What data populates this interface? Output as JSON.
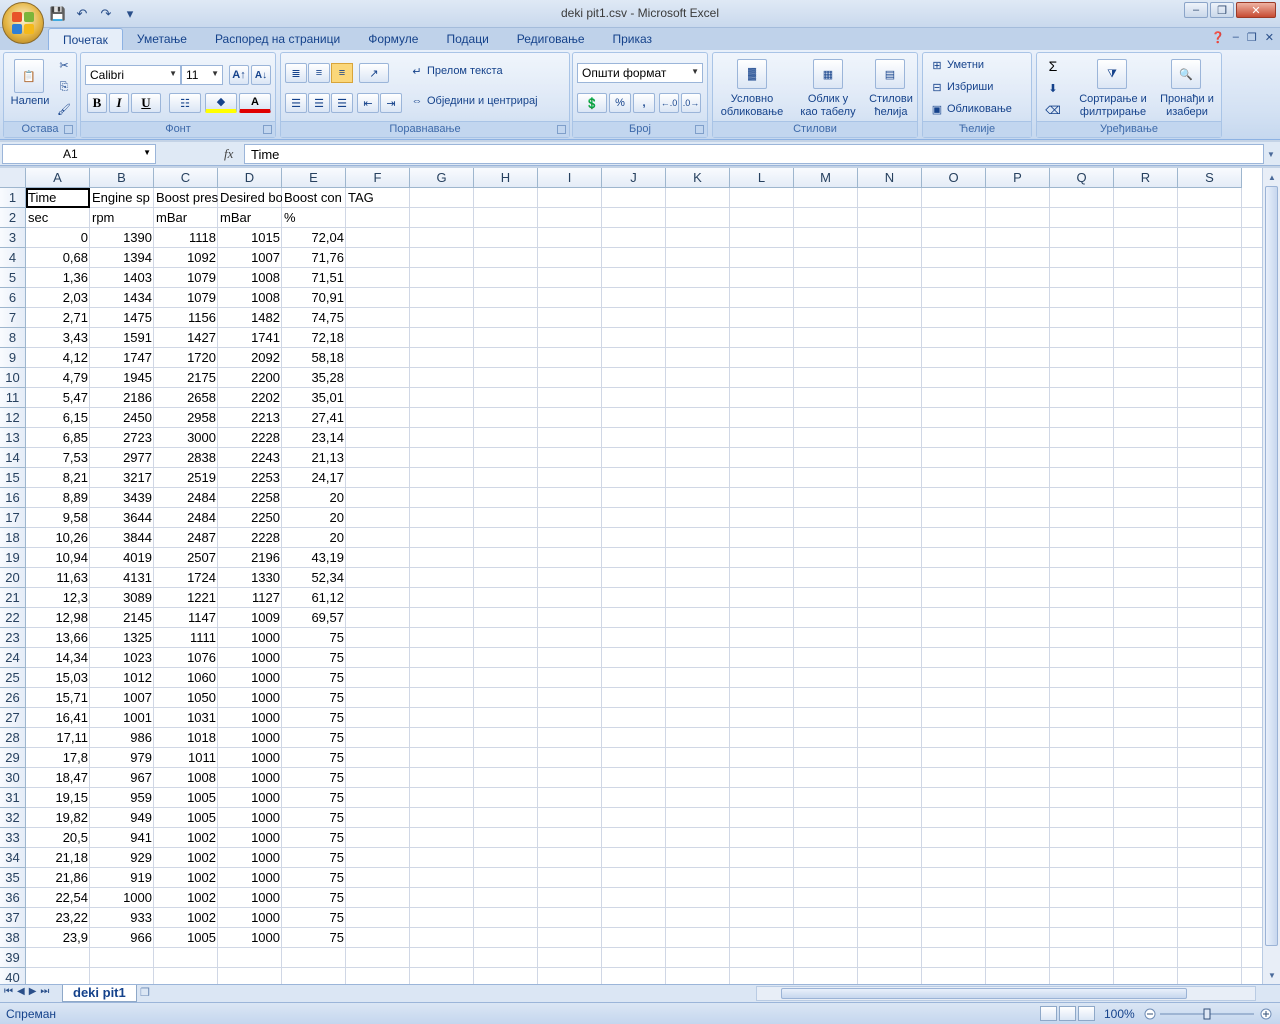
{
  "window": {
    "title": "deki pit1.csv - Microsoft Excel"
  },
  "ribbon_tabs": [
    "Почетак",
    "Уметање",
    "Распоред на страници",
    "Формуле",
    "Подаци",
    "Редиговање",
    "Приказ"
  ],
  "ribbon": {
    "clipboard": {
      "label": "Остава",
      "paste": "Налепи"
    },
    "font": {
      "label": "Фонт",
      "name": "Calibri",
      "size": "11"
    },
    "alignment": {
      "label": "Поравнавање",
      "wrap": "Прелом текста",
      "merge": "Обједини и центрирај"
    },
    "number": {
      "label": "Број",
      "format": "Општи формат",
      "percent": "%",
      "comma": ","
    },
    "styles": {
      "label": "Стилови",
      "conditional": [
        "Условно",
        "обликовање"
      ],
      "table": [
        "Облик у",
        "као табелу"
      ],
      "cell": [
        "Стилови",
        "ћелија"
      ]
    },
    "cells": {
      "label": "Ћелије",
      "insert": "Уметни",
      "delete": "Избриши",
      "format": "Обликовање"
    },
    "editing": {
      "label": "Уређивање",
      "sort": [
        "Сортирање и",
        "филтрирање"
      ],
      "find": [
        "Пронађи и",
        "изабери"
      ]
    }
  },
  "formula_bar": {
    "name_box": "A1",
    "fx": "fx",
    "content": "Time"
  },
  "columns": [
    "A",
    "B",
    "C",
    "D",
    "E",
    "F",
    "G",
    "H",
    "I",
    "J",
    "K",
    "L",
    "M",
    "N",
    "O",
    "P",
    "Q",
    "R",
    "S"
  ],
  "rows": [
    [
      "Time",
      "Engine sp",
      "Boost pres",
      "Desired bo",
      "Boost con",
      "TAG"
    ],
    [
      "sec",
      "rpm",
      "mBar",
      "mBar",
      "%",
      ""
    ],
    [
      "0",
      "1390",
      "1118",
      "1015",
      "72,04"
    ],
    [
      "0,68",
      "1394",
      "1092",
      "1007",
      "71,76"
    ],
    [
      "1,36",
      "1403",
      "1079",
      "1008",
      "71,51"
    ],
    [
      "2,03",
      "1434",
      "1079",
      "1008",
      "70,91"
    ],
    [
      "2,71",
      "1475",
      "1156",
      "1482",
      "74,75"
    ],
    [
      "3,43",
      "1591",
      "1427",
      "1741",
      "72,18"
    ],
    [
      "4,12",
      "1747",
      "1720",
      "2092",
      "58,18"
    ],
    [
      "4,79",
      "1945",
      "2175",
      "2200",
      "35,28"
    ],
    [
      "5,47",
      "2186",
      "2658",
      "2202",
      "35,01"
    ],
    [
      "6,15",
      "2450",
      "2958",
      "2213",
      "27,41"
    ],
    [
      "6,85",
      "2723",
      "3000",
      "2228",
      "23,14"
    ],
    [
      "7,53",
      "2977",
      "2838",
      "2243",
      "21,13"
    ],
    [
      "8,21",
      "3217",
      "2519",
      "2253",
      "24,17"
    ],
    [
      "8,89",
      "3439",
      "2484",
      "2258",
      "20"
    ],
    [
      "9,58",
      "3644",
      "2484",
      "2250",
      "20"
    ],
    [
      "10,26",
      "3844",
      "2487",
      "2228",
      "20"
    ],
    [
      "10,94",
      "4019",
      "2507",
      "2196",
      "43,19"
    ],
    [
      "11,63",
      "4131",
      "1724",
      "1330",
      "52,34"
    ],
    [
      "12,3",
      "3089",
      "1221",
      "1127",
      "61,12"
    ],
    [
      "12,98",
      "2145",
      "1147",
      "1009",
      "69,57"
    ],
    [
      "13,66",
      "1325",
      "1111",
      "1000",
      "75"
    ],
    [
      "14,34",
      "1023",
      "1076",
      "1000",
      "75"
    ],
    [
      "15,03",
      "1012",
      "1060",
      "1000",
      "75"
    ],
    [
      "15,71",
      "1007",
      "1050",
      "1000",
      "75"
    ],
    [
      "16,41",
      "1001",
      "1031",
      "1000",
      "75"
    ],
    [
      "17,11",
      "986",
      "1018",
      "1000",
      "75"
    ],
    [
      "17,8",
      "979",
      "1011",
      "1000",
      "75"
    ],
    [
      "18,47",
      "967",
      "1008",
      "1000",
      "75"
    ],
    [
      "19,15",
      "959",
      "1005",
      "1000",
      "75"
    ],
    [
      "19,82",
      "949",
      "1005",
      "1000",
      "75"
    ],
    [
      "20,5",
      "941",
      "1002",
      "1000",
      "75"
    ],
    [
      "21,18",
      "929",
      "1002",
      "1000",
      "75"
    ],
    [
      "21,86",
      "919",
      "1002",
      "1000",
      "75"
    ],
    [
      "22,54",
      "1000",
      "1002",
      "1000",
      "75"
    ],
    [
      "23,22",
      "933",
      "1002",
      "1000",
      "75"
    ],
    [
      "23,9",
      "966",
      "1005",
      "1000",
      "75"
    ]
  ],
  "total_rows_visible": 40,
  "sheet_tab": "deki pit1",
  "status": {
    "text": "Спреман",
    "zoom": "100%"
  }
}
